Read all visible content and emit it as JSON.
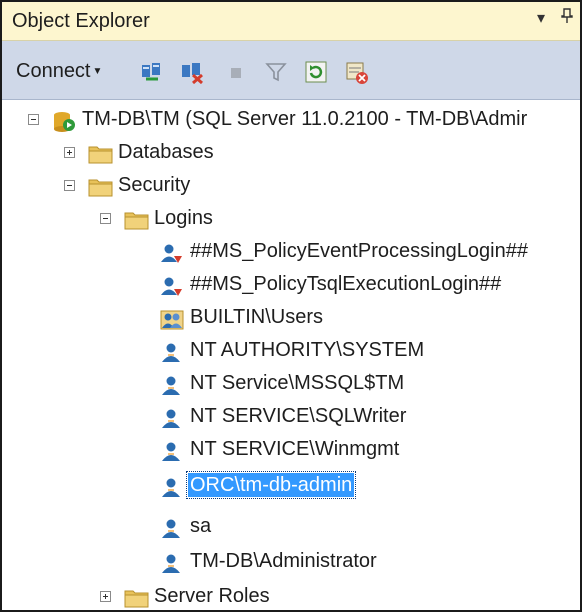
{
  "panel": {
    "title": "Object Explorer",
    "pin_glyph": "▾ ⊥"
  },
  "toolbar": {
    "connect_label": "Connect",
    "buttons": [
      "connect-icon",
      "disconnect-icon",
      "stop-icon",
      "filter-icon",
      "refresh-icon",
      "activity-icon"
    ]
  },
  "tree": {
    "server": "TM-DB\\TM (SQL Server 11.0.2100 - TM-DB\\Admir",
    "databases": "Databases",
    "security": "Security",
    "logins": "Logins",
    "login_items": [
      "##MS_PolicyEventProcessingLogin##",
      "##MS_PolicyTsqlExecutionLogin##",
      "BUILTIN\\Users",
      "NT AUTHORITY\\SYSTEM",
      "NT Service\\MSSQL$TM",
      "NT SERVICE\\SQLWriter",
      "NT SERVICE\\Winmgmt",
      "ORC\\tm-db-admin",
      "sa",
      "TM-DB\\Administrator"
    ],
    "server_roles": "Server Roles",
    "selected": "ORC\\tm-db-admin"
  },
  "colors": {
    "title_bg": "#fdf6cf",
    "toolbar_bg": "#cfd8e8",
    "selection": "#3399ff",
    "folder": "#e8c25a",
    "user_blue": "#2b6cb0"
  }
}
